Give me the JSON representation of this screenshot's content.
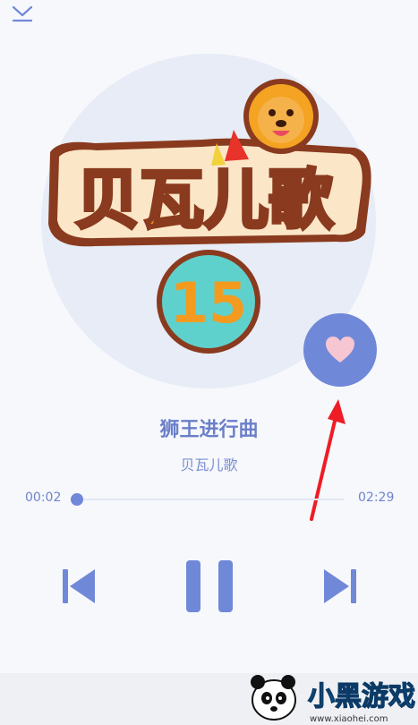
{
  "header": {
    "collapse_icon": "chevron-down-icon"
  },
  "album": {
    "cover_logo_text": "贝瓦儿歌",
    "cover_number": "15"
  },
  "like_icon": "heart-icon",
  "song": {
    "title": "狮王进行曲",
    "artist": "贝瓦儿歌"
  },
  "progress": {
    "current_time": "00:02",
    "total_time": "02:29",
    "fraction": 0.013
  },
  "controls": {
    "prev_icon": "skip-previous-icon",
    "pause_icon": "pause-icon",
    "next_icon": "skip-next-icon"
  },
  "watermark": {
    "brand_text": "小黑游戏",
    "url": "www.xiaohei.com"
  },
  "colors": {
    "accent": "#7088d8",
    "heart": "#f6c6d2",
    "annotation_arrow": "#ee1c25"
  }
}
